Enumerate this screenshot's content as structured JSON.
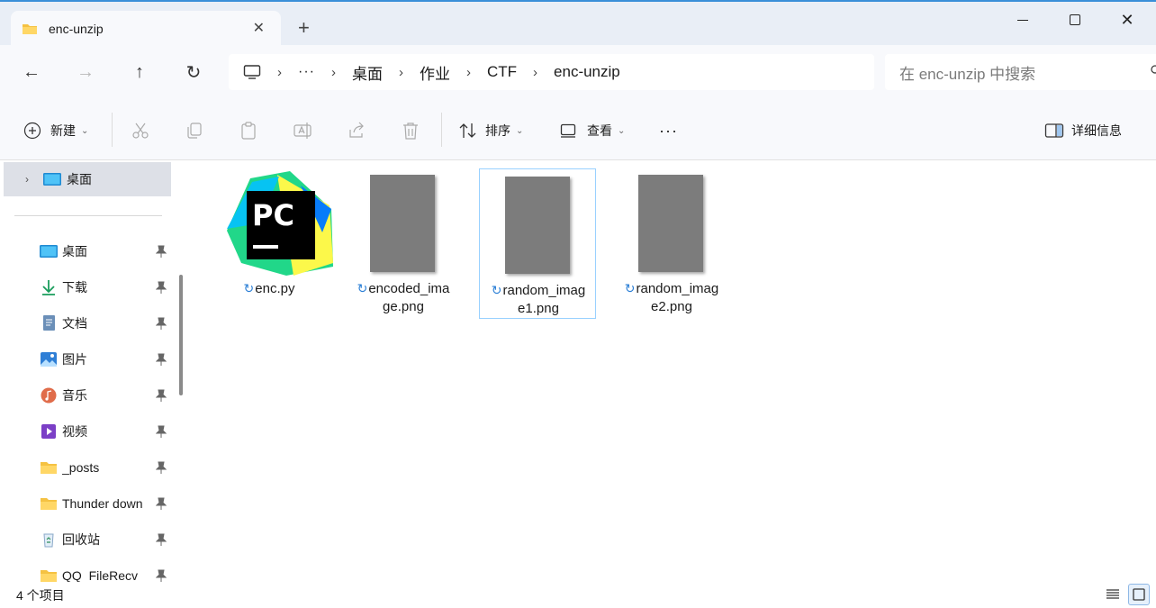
{
  "tab": {
    "title": "enc-unzip",
    "close_glyph": "✕",
    "new_glyph": "+"
  },
  "window": {
    "close_glyph": "✕"
  },
  "nav": {
    "back_glyph": "←",
    "forward_glyph": "→",
    "up_glyph": "↑",
    "refresh_glyph": "↻"
  },
  "address": {
    "more": "···",
    "separator": "›",
    "crumbs": [
      "桌面",
      "作业",
      "CTF",
      "enc-unzip"
    ]
  },
  "search": {
    "placeholder": "在 enc-unzip 中搜索"
  },
  "toolbar": {
    "new_label": "新建",
    "sort_label": "排序",
    "view_label": "查看",
    "more_glyph": "···",
    "details_label": "详细信息",
    "chevron": "⌄"
  },
  "navpane": {
    "top": {
      "label": "桌面",
      "arrow": "›"
    },
    "items": [
      {
        "label": "桌面",
        "icon": "desktop-icon"
      },
      {
        "label": "下载",
        "icon": "download-icon"
      },
      {
        "label": "文档",
        "icon": "document-icon"
      },
      {
        "label": "图片",
        "icon": "pictures-icon"
      },
      {
        "label": "音乐",
        "icon": "music-icon"
      },
      {
        "label": "视频",
        "icon": "video-icon"
      },
      {
        "label": "_posts",
        "icon": "folder-icon"
      },
      {
        "label": "Thunder down",
        "icon": "folder-icon"
      },
      {
        "label": "回收站",
        "icon": "recycle-bin-icon"
      },
      {
        "label": "QQ_FileRecv",
        "icon": "folder-icon"
      }
    ]
  },
  "files": [
    {
      "line1": "enc.py",
      "line2": "",
      "type": "pycharm-file",
      "selected": false
    },
    {
      "line1": "encoded_ima",
      "line2": "ge.png",
      "type": "image",
      "selected": false
    },
    {
      "line1": "random_imag",
      "line2": "e1.png",
      "type": "image",
      "selected": true
    },
    {
      "line1": "random_imag",
      "line2": "e2.png",
      "type": "image",
      "selected": false
    }
  ],
  "file_sync_glyph": "↻",
  "status": {
    "count": "4 个项目"
  },
  "colors": {
    "accent": "#2b7fd6",
    "selection_border": "#99d1ff",
    "chrome_bg": "#e9eef6"
  }
}
